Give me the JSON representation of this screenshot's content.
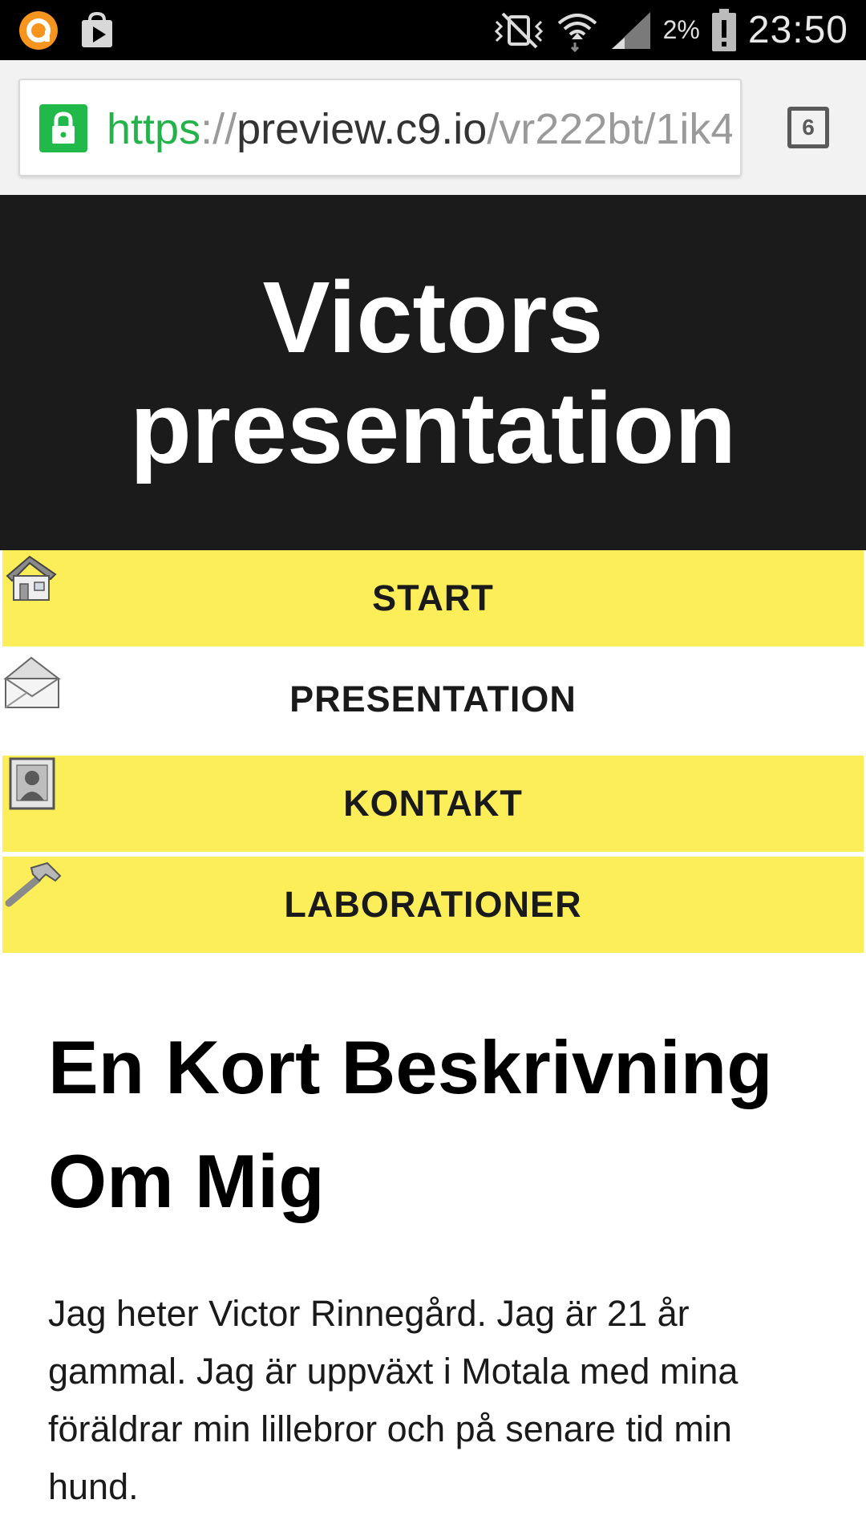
{
  "status_bar": {
    "battery_percent": "2%",
    "time": "23:50",
    "icons": [
      "browser-app-icon",
      "play-store-icon",
      "vibrate-mute-icon",
      "wifi-icon",
      "cell-signal-icon",
      "battery-low-icon"
    ]
  },
  "browser": {
    "url_scheme": "https",
    "url_separator": "://",
    "url_host": "preview.c9.io",
    "url_path": "/vr222bt/1ik4",
    "tab_count": "6",
    "lock_color": "#20b94a"
  },
  "header": {
    "title": "Victors presentation",
    "background": "#1b1b1b"
  },
  "nav": {
    "accent": "#fcee58",
    "items": [
      {
        "label": "START",
        "icon": "house-icon"
      },
      {
        "label": "PRESENTATION",
        "icon": "envelope-icon"
      },
      {
        "label": "KONTAKT",
        "icon": "contact-card-icon"
      },
      {
        "label": "LABORATIONER",
        "icon": "hammer-icon"
      }
    ]
  },
  "content": {
    "heading": "En Kort Beskrivning Om Mig",
    "paragraph": "Jag heter Victor Rinnegård. Jag är 21 år gammal. Jag är uppväxt i Motala med mina föräldrar min lillebror och på senare tid min hund."
  }
}
